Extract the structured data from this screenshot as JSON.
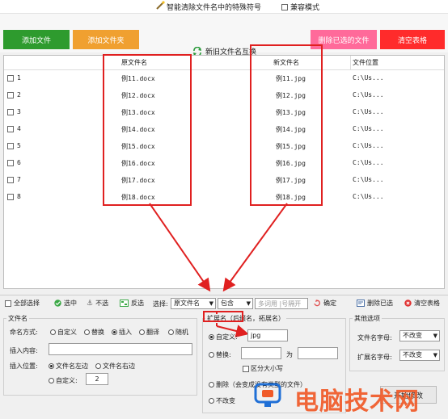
{
  "window": {
    "title": "智能清除文件名中的特殊符号",
    "compat_mode": "兼容模式"
  },
  "toolbar": {
    "add_files": "添加文件",
    "add_folder": "添加文件夹",
    "swap_names": "新旧文件名互换",
    "delete_selected": "删除已选的文件",
    "clear_table": "清空表格",
    "colors": {
      "add_files": "#2e9b2e",
      "add_folder": "#f0a030",
      "delete_selected": "#ff6a9a",
      "clear_table": "#ff2b2b"
    }
  },
  "table": {
    "headers": {
      "original": "原文件名",
      "new": "新文件名",
      "location": "文件位置"
    },
    "rows": [
      {
        "index": "1",
        "original": "例11.docx",
        "new": "例11.jpg",
        "location": "C:\\Us..."
      },
      {
        "index": "2",
        "original": "例12.docx",
        "new": "例12.jpg",
        "location": "C:\\Us..."
      },
      {
        "index": "3",
        "original": "例13.docx",
        "new": "例13.jpg",
        "location": "C:\\Us..."
      },
      {
        "index": "4",
        "original": "例14.docx",
        "new": "例14.jpg",
        "location": "C:\\Us..."
      },
      {
        "index": "5",
        "original": "例15.docx",
        "new": "例15.jpg",
        "location": "C:\\Us..."
      },
      {
        "index": "6",
        "original": "例16.docx",
        "new": "例16.jpg",
        "location": "C:\\Us..."
      },
      {
        "index": "7",
        "original": "例17.docx",
        "new": "例17.jpg",
        "location": "C:\\Us..."
      },
      {
        "index": "8",
        "original": "例18.docx",
        "new": "例18.jpg",
        "location": "C:\\Us..."
      }
    ]
  },
  "statusbar": {
    "select_all": "全部选择",
    "select": "选中",
    "deselect": "不选",
    "invert": "反选",
    "choose_label": "选择:",
    "choose_value": "原文件名",
    "contains_value": "包含",
    "filter_placeholder": "多词用 |号隔开",
    "confirm": "确定",
    "delete_selected": "删除已选",
    "clear_table": "清空表格"
  },
  "filename_panel": {
    "title": "文件名",
    "naming_label": "命名方式:",
    "naming_options": [
      "自定义",
      "替换",
      "插入",
      "翻译",
      "随机"
    ],
    "naming_selected": "插入",
    "insert_content_label": "插入内容:",
    "insert_content_value": "",
    "insert_pos_label": "插入位置:",
    "pos_options": [
      "文件名左边",
      "文件名右边"
    ],
    "pos_selected": "文件名左边",
    "custom_label": "自定义:",
    "custom_value": "2"
  },
  "ext_panel": {
    "title": "扩展名（后缀名，拓展名）",
    "custom_label": "自定义:",
    "custom_value": "jpg",
    "replace_label": "替换:",
    "replace_for": "为",
    "case_sensitive": "区分大小写",
    "delete_label": "删除（会变成没有类型的文件）",
    "unchanged_label": "不改变",
    "selected": "自定义"
  },
  "other_panel": {
    "title": "其他选项",
    "filename_case_label": "文件名字母:",
    "filename_case_value": "不改变",
    "ext_case_label": "扩展名字母:",
    "ext_case_value": "不改变",
    "start_button": "开始修改"
  },
  "watermark": {
    "text": "电脑技术网"
  }
}
